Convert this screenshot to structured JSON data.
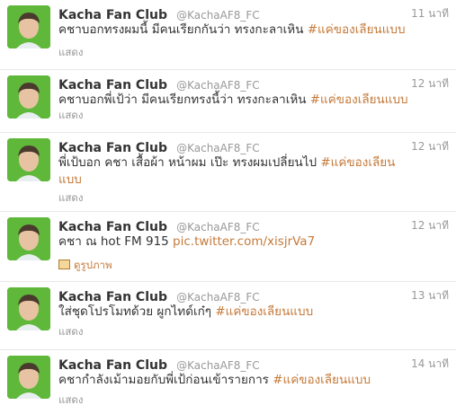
{
  "tweets": [
    {
      "name": "Kacha Fan Club",
      "handle": "@KachaAF8_FC",
      "time": "11 นาที",
      "text": "คชาบอกทรงผมนี้ มีคนเรียกกันว่า ทรงกะลาเหิน ",
      "hashtag": "#แค่ของเลียนแบบ",
      "action": "แสดง"
    },
    {
      "name": "Kacha Fan Club",
      "handle": "@KachaAF8_FC",
      "time": "12 นาที",
      "text": "คชาบอกพี่เป้ว่า มีคนเรียกทรงนี้ว่า ทรงกะลาเหิน ",
      "hashtag": "#แค่ของเลียนแบบ",
      "action": "แสดง"
    },
    {
      "name": "Kacha Fan Club",
      "handle": "@KachaAF8_FC",
      "time": "12 นาที",
      "text": "พี่เป้บอก คชา เสื้อผ้า หน้าผม เป๊ะ ทรงผมเปลี่ยนไป ",
      "hashtag": "#แค่ของเลียนแบบ",
      "action": "แสดง"
    },
    {
      "name": "Kacha Fan Club",
      "handle": "@KachaAF8_FC",
      "time": "12 นาที",
      "text": "คชา ณ hot FM 915 ",
      "link": "pic.twitter.com/xisjrVa7",
      "action": "ดูรูปภาพ"
    },
    {
      "name": "Kacha Fan Club",
      "handle": "@KachaAF8_FC",
      "time": "13 นาที",
      "text": "ใส่ชุดโปรโมทด้วย ผูกไทด์เก๋ๆ ",
      "hashtag": "#แค่ของเลียนแบบ",
      "action": "แสดง"
    },
    {
      "name": "Kacha Fan Club",
      "handle": "@KachaAF8_FC",
      "time": "14 นาที",
      "text": "คชากำลังเม้ามอยกับพี่เป้ก่อนเข้ารายการ ",
      "hashtag": "#แค่ของเลียนแบบ",
      "action": "แสดง"
    }
  ]
}
